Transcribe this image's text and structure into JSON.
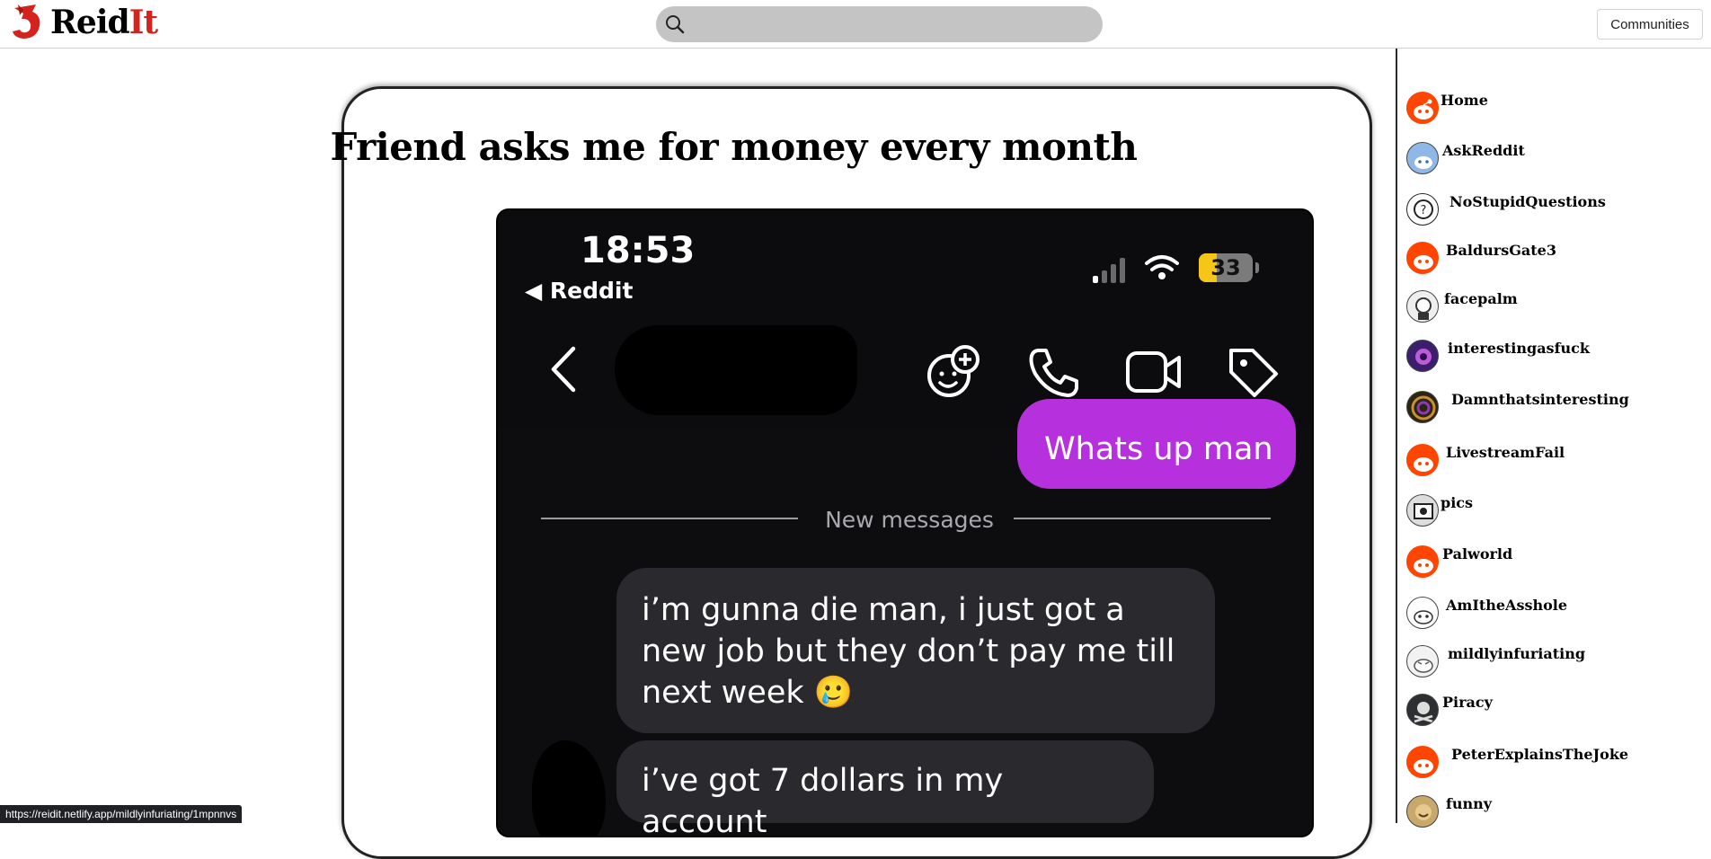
{
  "header": {
    "logo_text_prefix": "Reid",
    "logo_text_suffix": "It",
    "search_placeholder": "",
    "communities_label": "Communities"
  },
  "sidebar": {
    "items": [
      {
        "label": "Home",
        "icon": "reddit-alien-icon"
      },
      {
        "label": "AskReddit",
        "icon": "askreddit-icon"
      },
      {
        "label": "NoStupidQuestions",
        "icon": "question-bubble-icon"
      },
      {
        "label": "BaldursGate3",
        "icon": "reddit-alien-icon"
      },
      {
        "label": "facepalm",
        "icon": "facepalm-icon"
      },
      {
        "label": "interestingasfuck",
        "icon": "interestingasfuck-icon"
      },
      {
        "label": "Damnthatsinteresting",
        "icon": "damnthatsinteresting-icon"
      },
      {
        "label": "LivestreamFail",
        "icon": "reddit-alien-icon"
      },
      {
        "label": "pics",
        "icon": "pics-icon"
      },
      {
        "label": "Palworld",
        "icon": "reddit-alien-icon"
      },
      {
        "label": "AmItheAsshole",
        "icon": "amitheasshole-icon"
      },
      {
        "label": "mildlyinfuriating",
        "icon": "mildlyinfuriating-icon"
      },
      {
        "label": "Piracy",
        "icon": "piracy-icon"
      },
      {
        "label": "PeterExplainsTheJoke",
        "icon": "reddit-alien-icon"
      },
      {
        "label": "funny",
        "icon": "funny-icon"
      }
    ]
  },
  "post": {
    "title": "Friend asks me for money every month",
    "image": {
      "time": "18:53",
      "back_app": "◀ Reddit",
      "battery": "33",
      "my_message": "Whats up man",
      "divider_label": "New messages",
      "their_message_1": "i’m gunna die man, i just got a new job but they don’t pay me till next week 🥲",
      "their_message_2": "i’ve got 7 dollars in my account"
    }
  },
  "status_bar": {
    "url": "https://reidit.netlify.app/mildlyinfuriating/1mpnnvs"
  },
  "colors": {
    "brand_red": "#d4221f",
    "search_bg": "#c4c4c4",
    "my_bubble": "#b631dd",
    "their_bubble": "#29292e",
    "reddit_orange": "#ff4500"
  }
}
